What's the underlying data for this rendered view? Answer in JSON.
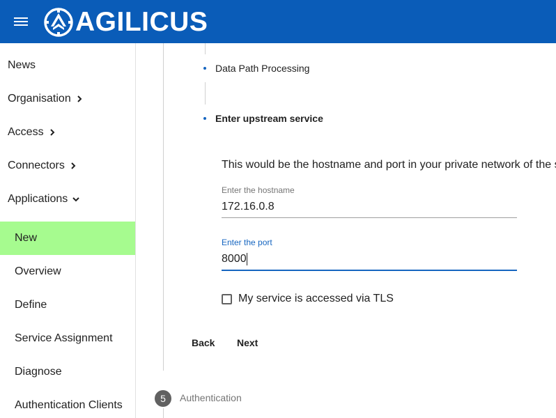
{
  "app": {
    "brand": "AGILICUS",
    "colors": {
      "header": "#0a5cb8",
      "active_nav": "#a6fb8f",
      "accent": "#1565c0"
    }
  },
  "sidebar": {
    "items": [
      {
        "label": "News",
        "icon": ""
      },
      {
        "label": "Organisation",
        "icon": "chevron-right-icon"
      },
      {
        "label": "Access",
        "icon": "chevron-right-icon"
      },
      {
        "label": "Connectors",
        "icon": "chevron-right-icon"
      },
      {
        "label": "Applications",
        "icon": "chevron-down-icon"
      }
    ],
    "subitems": [
      {
        "label": "New",
        "active": true
      },
      {
        "label": "Overview"
      },
      {
        "label": "Define"
      },
      {
        "label": "Service Assignment"
      },
      {
        "label": "Diagnose"
      },
      {
        "label": "Authentication Clients"
      }
    ]
  },
  "stepper": {
    "substeps": [
      {
        "label": "Data Path Processing"
      },
      {
        "label": "Enter upstream service"
      }
    ],
    "description": "This would be the hostname and port in your private network of the s",
    "hostname": {
      "label": "Enter the hostname",
      "value": "172.16.0.8"
    },
    "port": {
      "label": "Enter the port",
      "value": "8000"
    },
    "tls_checkbox": {
      "label": "My service is accessed via TLS",
      "checked": false
    },
    "back_label": "Back",
    "next_label": "Next",
    "next_step": {
      "number": "5",
      "label": "Authentication"
    }
  }
}
